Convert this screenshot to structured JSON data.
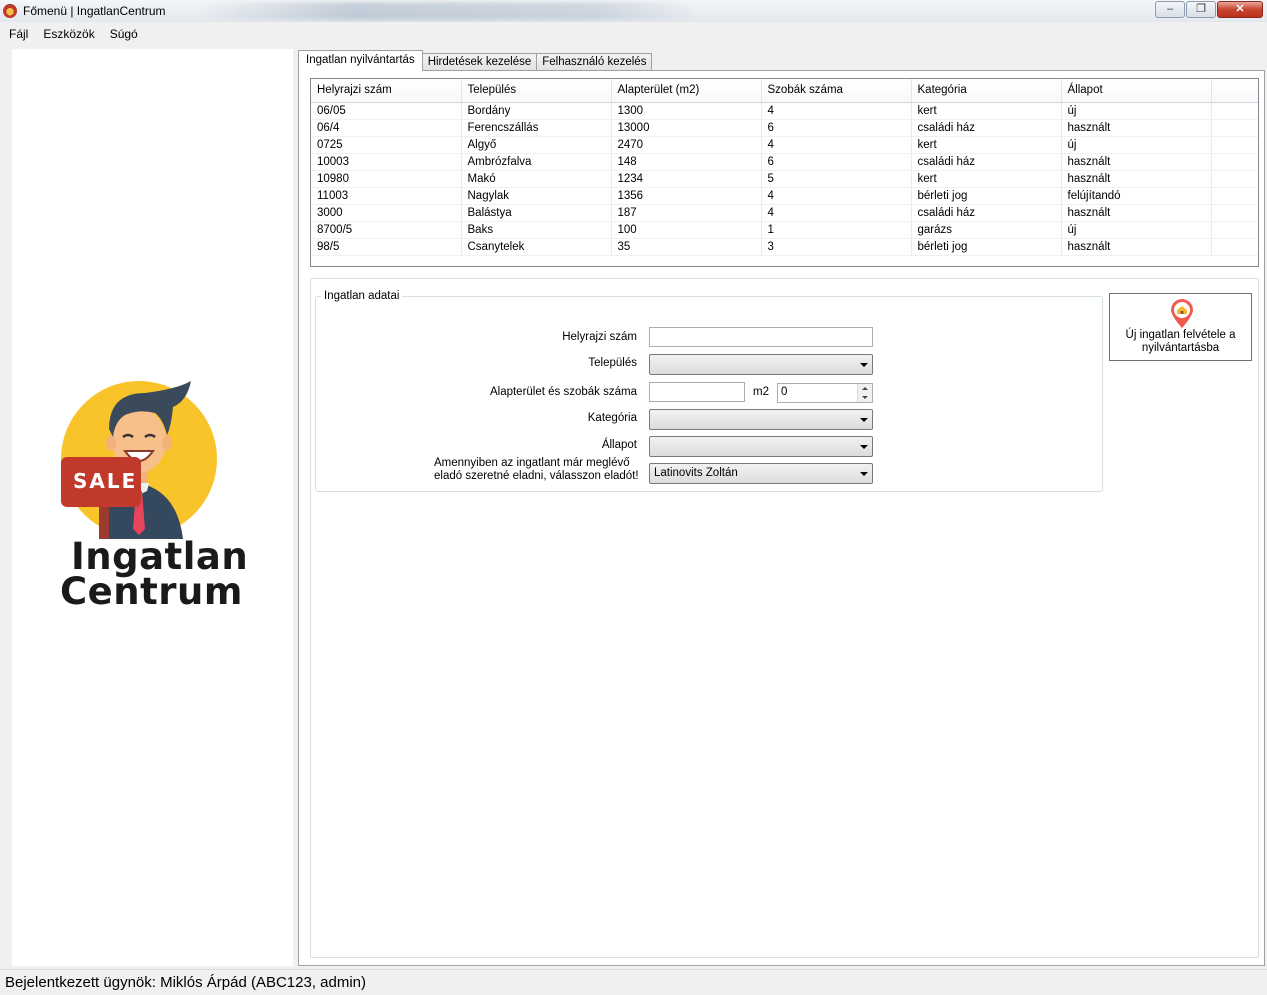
{
  "window": {
    "title": "Főmenü | IngatlanCentrum",
    "minimize_label": "–",
    "maximize_label": "❐",
    "close_label": "✕"
  },
  "menu": [
    "Fájl",
    "Eszközök",
    "Súgó"
  ],
  "logo": {
    "badge": "SALE",
    "line1": "Ingatlan",
    "line2": "Centrum"
  },
  "tabs": [
    "Ingatlan nyilvántartás",
    "Hirdetések kezelése",
    "Felhasználó kezelés"
  ],
  "grid": {
    "columns": [
      "Helyrajzi szám",
      "Település",
      "Alapterület (m2)",
      "Szobák száma",
      "Kategória",
      "Állapot"
    ],
    "rows": [
      [
        "06/05",
        "Bordány",
        "1300",
        "4",
        "kert",
        "új"
      ],
      [
        "06/4",
        "Ferencszállás",
        "13000",
        "6",
        "családi ház",
        "használt"
      ],
      [
        "0725",
        "Algyő",
        "2470",
        "4",
        "kert",
        "új"
      ],
      [
        "10003",
        "Ambrózfalva",
        "148",
        "6",
        "családi ház",
        "használt"
      ],
      [
        "10980",
        "Makó",
        "1234",
        "5",
        "kert",
        "használt"
      ],
      [
        "11003",
        "Nagylak",
        "1356",
        "4",
        "bérleti jog",
        "felújítandó"
      ],
      [
        "3000",
        "Balástya",
        "187",
        "4",
        "családi ház",
        "használt"
      ],
      [
        "8700/5",
        "Baks",
        "100",
        "1",
        "garázs",
        "új"
      ],
      [
        "98/5",
        "Csanytelek",
        "35",
        "3",
        "bérleti jog",
        "használt"
      ]
    ]
  },
  "form": {
    "group_title": "Ingatlan adatai",
    "lot_number_label": "Helyrajzi szám",
    "lot_number_value": "",
    "settlement_label": "Település",
    "settlement_value": "",
    "area_rooms_label": "Alapterület és szobák száma",
    "area_value": "",
    "area_unit": "m2",
    "rooms_value": "0",
    "category_label": "Kategória",
    "category_value": "",
    "condition_label": "Állapot",
    "condition_value": "",
    "seller_label_line1": "Amennyiben az ingatlant már meglévő",
    "seller_label_line2": "eladó szeretné eladni, válasszon eladót!",
    "seller_value": "Latinovits Zoltán"
  },
  "add_button": {
    "line1": "Új ingatlan felvétele a",
    "line2": "nyilvántartásba",
    "icon": "house-pin-icon"
  },
  "status": "Bejelentkezett ügynök: Miklós Árpád (ABC123, admin)"
}
